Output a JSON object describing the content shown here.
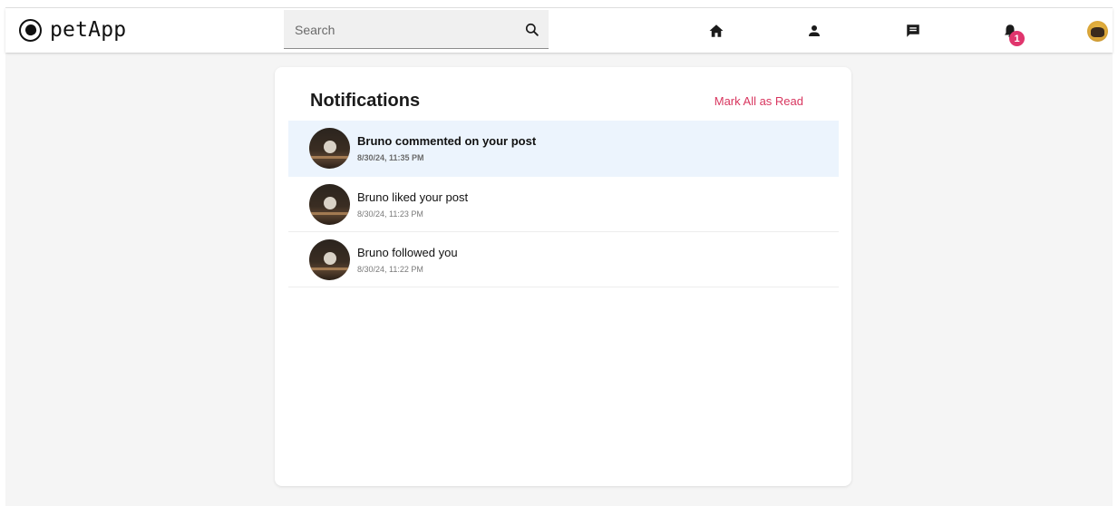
{
  "header": {
    "brand_name": "petApp",
    "search": {
      "placeholder": "Search",
      "value": ""
    },
    "nav": [
      "home-icon",
      "person-icon",
      "chat-icon",
      "bell-icon"
    ],
    "notification_count": "1",
    "accent_color": "#e0356d"
  },
  "notifications": {
    "title": "Notifications",
    "mark_all_label": "Mark All as Read",
    "items": [
      {
        "message": "Bruno commented on your post",
        "time": "8/30/24, 11:35 PM",
        "unread": true
      },
      {
        "message": "Bruno liked your post",
        "time": "8/30/24, 11:23 PM",
        "unread": false
      },
      {
        "message": "Bruno followed you",
        "time": "8/30/24, 11:22 PM",
        "unread": false
      }
    ]
  }
}
